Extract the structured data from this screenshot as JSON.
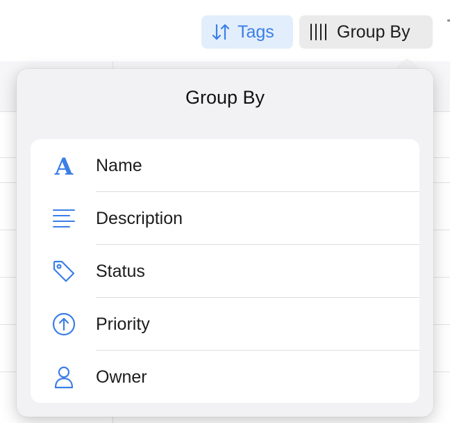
{
  "toolbar": {
    "tags_label": "Tags",
    "tags_icon": "sort-arrows-icon",
    "group_by_label": "Group By",
    "group_by_icon": "columns-icon"
  },
  "popover": {
    "title": "Group By",
    "options": [
      {
        "label": "Name",
        "icon": "letter-a-icon"
      },
      {
        "label": "Description",
        "icon": "text-lines-icon"
      },
      {
        "label": "Status",
        "icon": "tag-icon"
      },
      {
        "label": "Priority",
        "icon": "arrow-up-circle-icon"
      },
      {
        "label": "Owner",
        "icon": "person-icon"
      }
    ]
  },
  "colors": {
    "accent": "#3b7ee6",
    "tags_button_bg": "#e3eefc",
    "group_button_bg": "#ebebeb",
    "popover_bg": "#f2f2f4",
    "card_bg": "#ffffff"
  }
}
